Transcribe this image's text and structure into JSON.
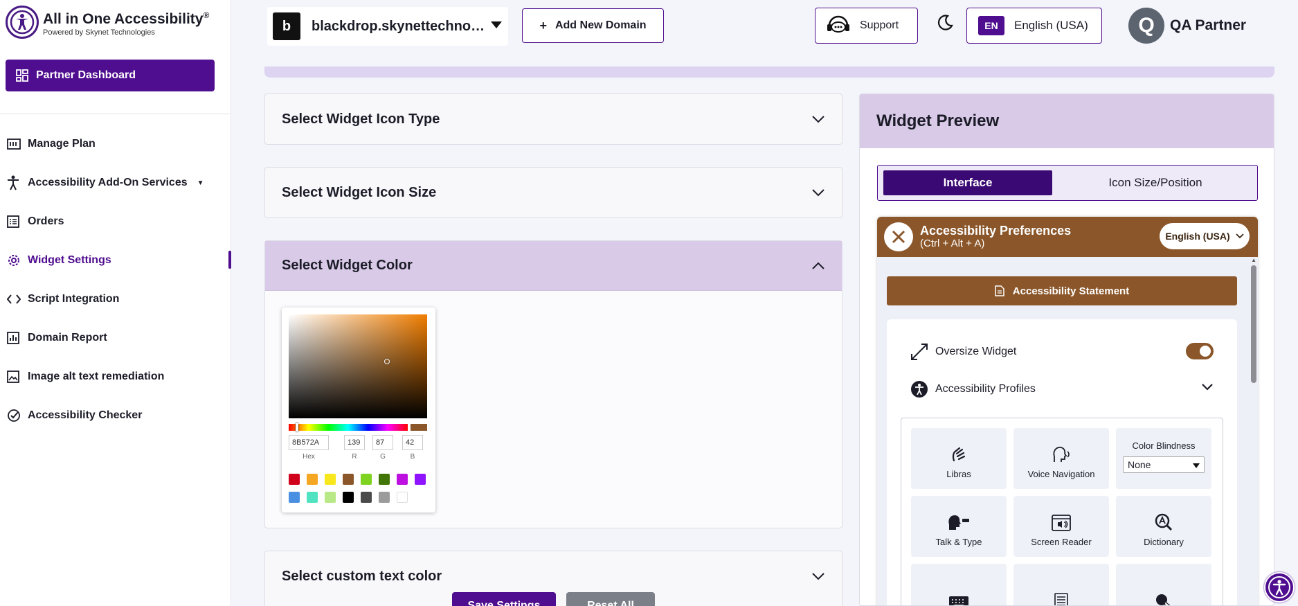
{
  "brand": {
    "title": "All in One Accessibility",
    "reg": "®",
    "subtitle": "Powered by Skynet Technologies"
  },
  "sidebar": {
    "partner_dashboard": "Partner Dashboard",
    "items": [
      {
        "label": "Manage Plan",
        "icon": "plan-icon"
      },
      {
        "label": "Accessibility Add-On Services",
        "icon": "person-icon",
        "has_submenu": true
      },
      {
        "label": "Orders",
        "icon": "list-icon"
      },
      {
        "label": "Widget Settings",
        "icon": "gear-icon",
        "active": true
      },
      {
        "label": "Script Integration",
        "icon": "code-icon"
      },
      {
        "label": "Domain Report",
        "icon": "bar-chart-icon"
      },
      {
        "label": "Image alt text remediation",
        "icon": "image-icon"
      },
      {
        "label": "Accessibility Checker",
        "icon": "check-circle-icon"
      }
    ]
  },
  "topbar": {
    "domain_badge": "b",
    "domain": "blackdrop.skynettechnologies.us",
    "add_domain": "Add New Domain",
    "support": "Support",
    "lang_code": "EN",
    "language": "English (USA)",
    "user_initial": "Q",
    "user_name": "QA Partner"
  },
  "accordions": {
    "icon_type": "Select Widget Icon Type",
    "icon_size": "Select Widget Icon Size",
    "color": "Select Widget Color",
    "custom_text": "Select custom text color"
  },
  "color_picker": {
    "hex": "8B572A",
    "r": "139",
    "g": "87",
    "b": "42",
    "hex_label": "Hex",
    "r_label": "R",
    "g_label": "G",
    "b_label": "B",
    "selected": "#8B572A",
    "swatches": [
      "#D0021B",
      "#F5A623",
      "#F8E71C",
      "#8B572A",
      "#7ED321",
      "#417505",
      "#BD10E0",
      "#9013FE",
      "#4A90E2",
      "#50E3C2",
      "#B8E986",
      "#000000",
      "#4A4A4A",
      "#9B9B9B",
      "#FFFFFF"
    ]
  },
  "actions": {
    "save": "Save Settings",
    "reset": "Reset All"
  },
  "preview": {
    "title": "Widget Preview",
    "tab_interface": "Interface",
    "tab_icon": "Icon Size/Position",
    "widget_title": "Accessibility Preferences",
    "widget_shortcut": "(Ctrl + Alt + A)",
    "widget_lang": "English (USA)",
    "statement": "Accessibility Statement",
    "oversize": "Oversize Widget",
    "profiles": "Accessibility Profiles",
    "tiles": {
      "libras": "Libras",
      "voice_nav": "Voice Navigation",
      "color_blindness": "Color Blindness",
      "color_blindness_value": "None",
      "talk_type": "Talk & Type",
      "screen_reader": "Screen Reader",
      "dictionary": "Dictionary"
    },
    "accent_color": "#8B572A"
  }
}
